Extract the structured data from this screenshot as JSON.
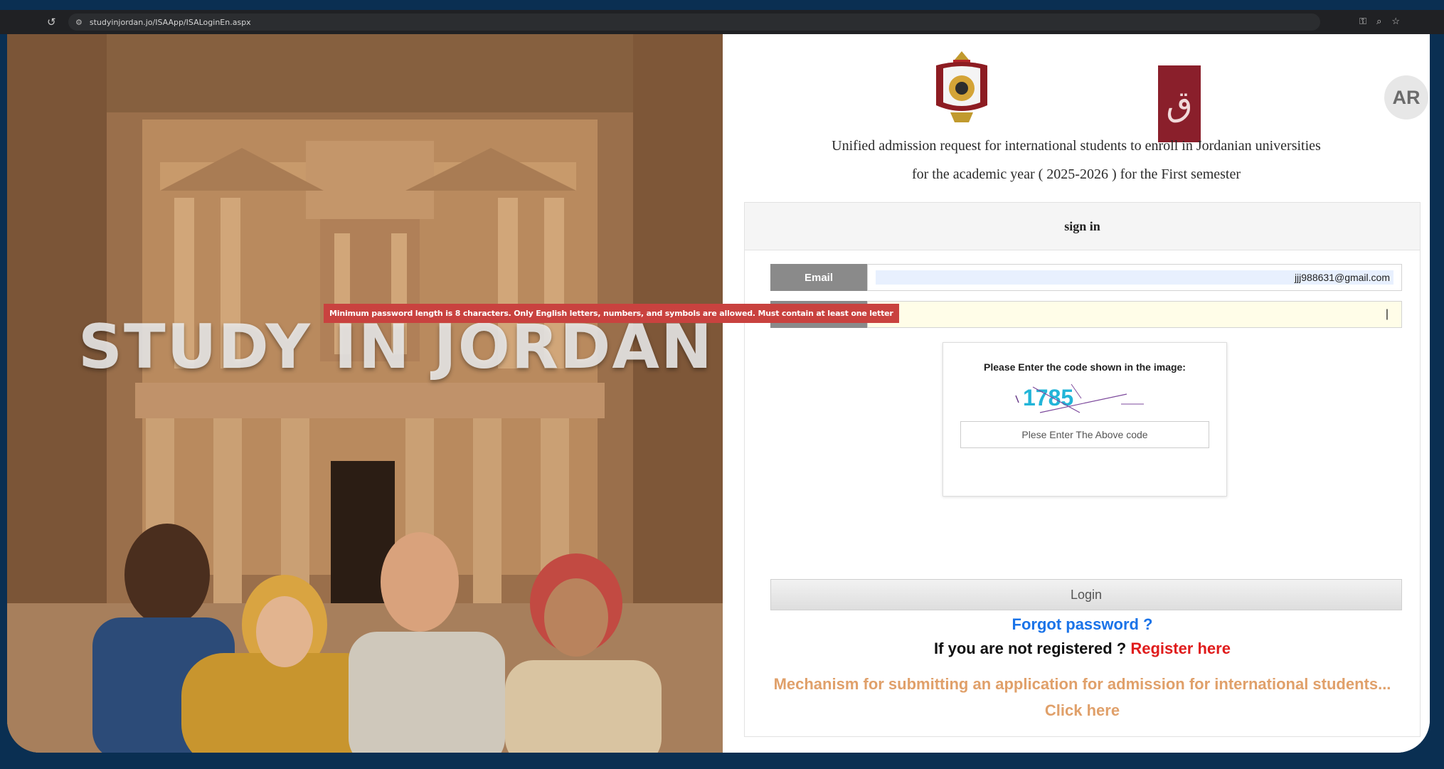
{
  "browser": {
    "url": "studyinjordan.jo/ISAApp/ISALoginEn.aspx",
    "icons": [
      "reload-icon",
      "tune-icon",
      "key-icon",
      "zoom-icon",
      "star-icon"
    ]
  },
  "hero": {
    "title": "STUDY IN JORDAN"
  },
  "header": {
    "logo_text": "",
    "logo_box_glyph": "ق",
    "language_button": "AR",
    "line1": "Unified admission request for international students to enroll in Jordanian universities",
    "line2": "for the academic year ( 2025-2026 ) for the First semester"
  },
  "signin": {
    "title": "sign in",
    "email_label": "Email",
    "email_value": "jjj988631@gmail.com",
    "password_tooltip": "Minimum password length is 8 characters. Only English letters, numbers, and symbols are allowed. Must contain at least one letter",
    "captcha_label": "Please Enter the code shown in the image:",
    "captcha_code": "1785",
    "captcha_placeholder": "Plese Enter The Above code",
    "login_label": "Login",
    "forgot_label": "Forgot password ?",
    "not_registered": "If you are not registered ?",
    "register_label": "Register here",
    "mechanism_label": "Mechanism for submitting an application for admission for international students...",
    "click_here": "Click here"
  },
  "colors": {
    "page_border": "#0a2f52",
    "label_gray": "#8a8a8a",
    "tooltip_red": "#c9423f",
    "link_blue": "#1a73e8",
    "register_red": "#e01c1c",
    "mechanism_orange": "#e0a06a",
    "logo_maroon": "#8a1f2b",
    "captcha_cyan": "#22b5d8"
  }
}
